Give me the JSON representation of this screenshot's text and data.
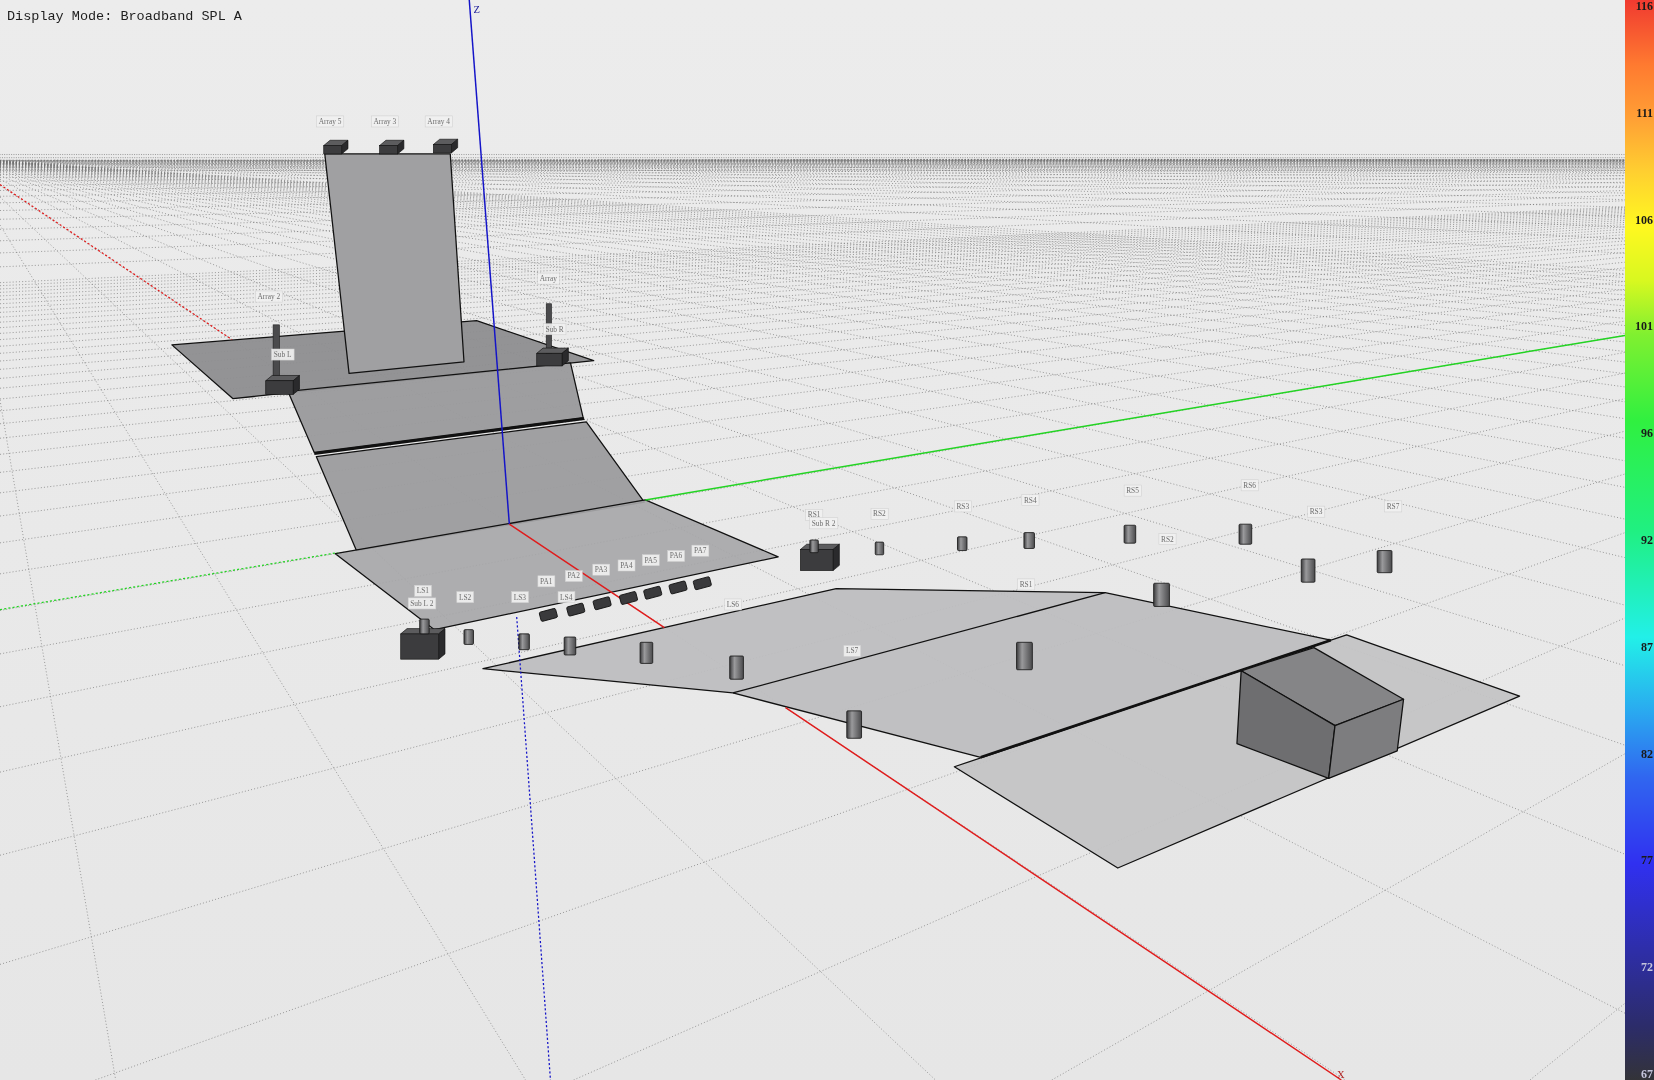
{
  "display_mode": "Display Mode: Broadband SPL A",
  "viewport": {
    "axis_labels": [
      "Z",
      "X"
    ],
    "object_labels": [
      "Array 5",
      "Array 3",
      "Array 4",
      "Array 2",
      "Array",
      "Sub L",
      "Sub R",
      "LS1",
      "Sub L 2",
      "LS2",
      "LS3",
      "LS4",
      "PA1",
      "PA2",
      "PA3",
      "PA4",
      "PA5",
      "PA6",
      "PA7",
      "LS6",
      "LS7",
      "RS1",
      "Sub R 2",
      "RS2",
      "RS3",
      "RS4",
      "RS5",
      "RS6",
      "RS2",
      "RS3",
      "RS7",
      "RS1"
    ]
  },
  "color_scale": {
    "ticks": [
      "116",
      "111",
      "106",
      "101",
      "96",
      "92",
      "87",
      "82",
      "77",
      "72",
      "67"
    ]
  }
}
